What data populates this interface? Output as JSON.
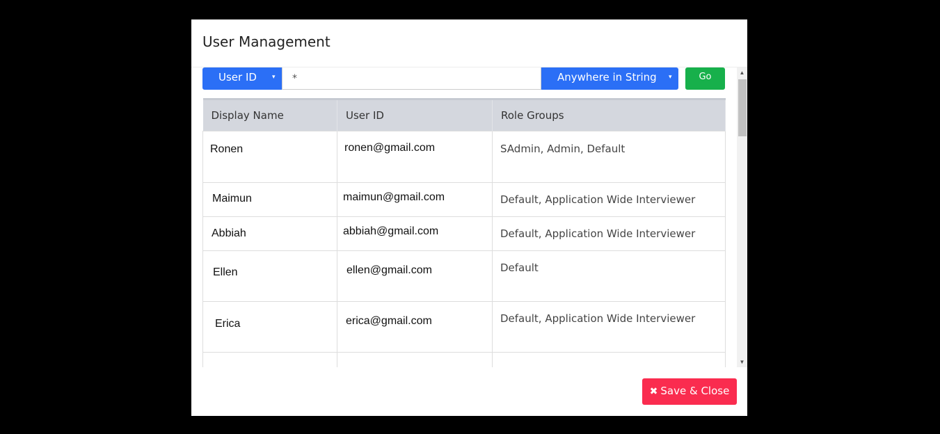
{
  "modal": {
    "title": "User Management"
  },
  "search": {
    "field_select": "User ID",
    "field_caret": "▾",
    "query_value": "*",
    "match_select": "Anywhere in String",
    "match_caret": "▾",
    "go_label": "Go"
  },
  "table": {
    "headers": [
      "Display Name",
      "User ID",
      "Role Groups"
    ],
    "rows": [
      {
        "display_name": "Ronen",
        "user_id": "ronen@gmail.com",
        "role_groups": "SAdmin, Admin, Default"
      },
      {
        "display_name": "Maimun",
        "user_id": "maimun@gmail.com",
        "role_groups": "Default, Application Wide Interviewer"
      },
      {
        "display_name": "Abbiah",
        "user_id": "abbiah@gmail.com",
        "role_groups": "Default, Application Wide Interviewer"
      },
      {
        "display_name": "Ellen",
        "user_id": "ellen@gmail.com",
        "role_groups": "Default"
      },
      {
        "display_name": "Erica",
        "user_id": "erica@gmail.com",
        "role_groups": "Default, Application Wide Interviewer"
      },
      {
        "display_name": "",
        "user_id": "",
        "role_groups": ""
      }
    ]
  },
  "scrollbar": {
    "up_arrow": "▲",
    "down_arrow": "▼"
  },
  "footer": {
    "save_close_icon": "✖",
    "save_close_label": "Save & Close"
  },
  "colors": {
    "primary": "#2b6ff6",
    "success": "#17b04b",
    "danger": "#fa2c4f",
    "table_header": "#d4d7de"
  }
}
